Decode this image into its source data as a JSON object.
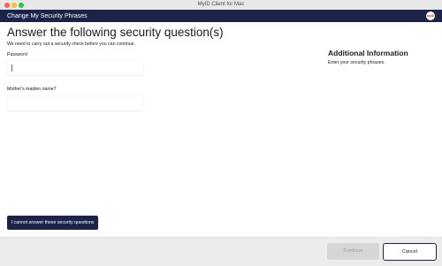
{
  "window": {
    "title": "MyID Client for Mac"
  },
  "appbar": {
    "title": "Change My Security Phrases",
    "logo_text": "myID",
    "logo_icon": "myid-logo-icon",
    "background": "#1c2348"
  },
  "main": {
    "heading": "Answer the following security question(s)",
    "intro": "We need to carry out a security check before you can continue.",
    "fields": [
      {
        "label": "Password",
        "value": "",
        "placeholder": ""
      },
      {
        "label": "Mother's maiden name?",
        "value": "",
        "placeholder": ""
      }
    ],
    "cannot_answer_label": "I cannot answer these security questions"
  },
  "sidebar": {
    "heading": "Additional Information",
    "text": "Enter your security phrases."
  },
  "footer": {
    "continue_label": "Continue",
    "continue_enabled": false,
    "cancel_label": "Cancel"
  },
  "colors": {
    "accent": "#1c2348",
    "caret": "#2a6ee0"
  }
}
